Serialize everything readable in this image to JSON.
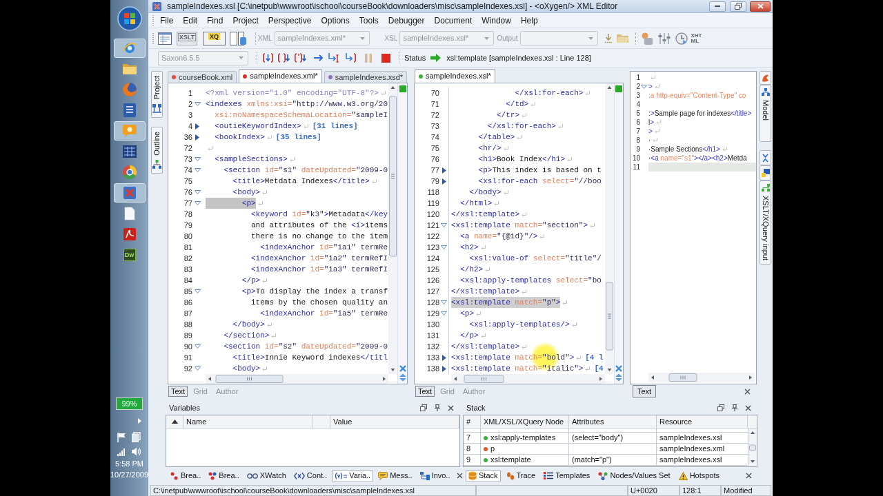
{
  "taskbar": {
    "apps": [
      {
        "kind": "ie",
        "open": true
      },
      {
        "kind": "folder",
        "open": false
      },
      {
        "kind": "firefox",
        "open": false
      },
      {
        "kind": "word",
        "open": false
      },
      {
        "kind": "chat",
        "open": true
      },
      {
        "kind": "grid",
        "open": false
      },
      {
        "kind": "globe",
        "open": false
      },
      {
        "kind": "oxygen",
        "open": true
      },
      {
        "kind": "page",
        "open": false
      },
      {
        "kind": "acrobat",
        "open": false
      },
      {
        "kind": "dw",
        "open": false,
        "text": "Dw"
      }
    ],
    "battery": {
      "reading": "99%",
      "level": 0.99
    },
    "time": "5:58 PM",
    "date": "10/27/2009"
  },
  "window": {
    "title": "sampleIndexes.xsl [C:\\inetpub\\wwwroot\\ischool\\courseBook\\downloaders\\misc\\sampleIndexes.xsl] - <oXygen/> XML Editor"
  },
  "menu": [
    "File",
    "Edit",
    "Find",
    "Project",
    "Perspective",
    "Options",
    "Tools",
    "Debugger",
    "Document",
    "Window",
    "Help"
  ],
  "toolbar": {
    "xslt_icon_text": "XSLT",
    "xquery_icon_text": "XQ",
    "combos": [
      {
        "label": "XML",
        "value": "sampleIndexes.xml*",
        "disabled": true
      },
      {
        "label": "XSL",
        "value": "sampleIndexes.xsl*",
        "disabled": true
      },
      {
        "label": "Output",
        "disabled": true
      }
    ],
    "xhtml_icon_text": [
      "XHT",
      "ML"
    ]
  },
  "debug_bar": {
    "engine": {
      "value": "Saxon6.5.5",
      "disabled": true
    },
    "status_label": "Status",
    "status": "xsl:template [sampleIndexes.xsl : Line 128]"
  },
  "side_tabs": [
    {
      "label": "Project"
    },
    {
      "label": "Outline"
    }
  ],
  "editors": [
    {
      "tabs": [
        {
          "label": "courseBook.xml",
          "color": "#e24a3c",
          "selected": false
        },
        {
          "label": "sampleIndexes.xml*",
          "color": "#d8332a",
          "selected": true
        },
        {
          "label": "sampleIndexes.xsd*",
          "color": "#8e6fb5",
          "selected": false
        }
      ],
      "lines": [
        {
          "n": "1",
          "text": "<?xml version=\"1.0\" encoding=\"UTF-8\"?>",
          "eol": true,
          "highlighted": false
        },
        {
          "n": "2",
          "expanded": true,
          "text": "<indexes xmlns:xsi=\"http://www.w3.org/20",
          "eol": false,
          "highlighted": false
        },
        {
          "n": "3",
          "text": "  xsi:noNamespaceSchemaLocation=\"sampleI",
          "eol": false,
          "highlighted": false
        },
        {
          "n": "4",
          "expanded": false,
          "text": "  <outieKeywordIndex>",
          "eol": true,
          "summary": "[31 lines]",
          "highlighted": false
        },
        {
          "n": "36",
          "expanded": false,
          "text": "  <bookIndex>",
          "eol": true,
          "summary": "[35 lines]",
          "highlighted": false
        },
        {
          "n": "72",
          "eol": true,
          "highlighted": false
        },
        {
          "n": "73",
          "expanded": true,
          "text": "  <sampleSections>",
          "eol": true,
          "highlighted": false
        },
        {
          "n": "74",
          "expanded": true,
          "text": "    <section id=\"s1\" dateUpdated=\"2009-0",
          "eol": false,
          "highlighted": false
        },
        {
          "n": "75",
          "text": "      <title>Metdata Indexes</title>",
          "eol": true,
          "highlighted": false
        },
        {
          "n": "76",
          "expanded": true,
          "text": "      <body>",
          "eol": true,
          "highlighted": false
        },
        {
          "n": "77",
          "expanded": true,
          "text": "        <p>",
          "eol": true,
          "highlighted": true
        },
        {
          "n": "78",
          "text": "          <keyword id=\"k3\">Metadata</key",
          "eol": false,
          "highlighted": false
        },
        {
          "n": "79",
          "text": "          and attributes of the <i>items",
          "eol": false,
          "highlighted": false
        },
        {
          "n": "80",
          "text": "          there is no change to the item",
          "eol": false,
          "highlighted": false
        },
        {
          "n": "81",
          "text": "            <indexAnchor id=\"ia1\" termRe",
          "eol": false,
          "highlighted": false
        },
        {
          "n": "82",
          "text": "          <indexAnchor id=\"ia2\" termRefI",
          "eol": false,
          "highlighted": false
        },
        {
          "n": "83",
          "text": "          <indexAnchor id=\"ia3\" termRefI",
          "eol": false,
          "highlighted": false
        },
        {
          "n": "84",
          "text": "        </p>",
          "eol": true,
          "highlighted": false
        },
        {
          "n": "85",
          "expanded": true,
          "text": "        <p>To display the index a transf",
          "eol": false,
          "highlighted": false
        },
        {
          "n": "86",
          "text": "          items by the chosen quality an",
          "eol": false,
          "highlighted": false
        },
        {
          "n": "87",
          "text": "            <indexAnchor id=\"ia5\" termRe",
          "eol": false,
          "highlighted": false
        },
        {
          "n": "88",
          "text": "      </body>",
          "eol": true,
          "highlighted": false
        },
        {
          "n": "89",
          "text": "    </section>",
          "eol": true,
          "highlighted": false
        },
        {
          "n": "90",
          "expanded": true,
          "text": "    <section id=\"s2\" dateUpdated=\"2009-0",
          "eol": false,
          "highlighted": false
        },
        {
          "n": "91",
          "text": "      <title>Innie Keyword indexes</titl",
          "eol": false,
          "highlighted": false
        },
        {
          "n": "92",
          "expanded": true,
          "text": "      <body>",
          "eol": true,
          "highlighted": false
        }
      ],
      "modes": [
        {
          "label": "Text",
          "selected": true
        },
        {
          "label": "Grid",
          "selected": false
        },
        {
          "label": "Author",
          "selected": false
        }
      ]
    },
    {
      "tabs": [
        {
          "label": "sampleIndexes.xsl*",
          "color": "#3fae3a",
          "selected": true
        }
      ],
      "lines": [
        {
          "n": "70",
          "text": "              </xsl:for-each>",
          "eol": true,
          "highlighted": false
        },
        {
          "n": "71",
          "text": "            </td>",
          "eol": true,
          "highlighted": false
        },
        {
          "n": "72",
          "text": "          </tr>",
          "eol": true,
          "highlighted": false
        },
        {
          "n": "73",
          "text": "        </xsl:for-each>",
          "eol": true,
          "highlighted": false
        },
        {
          "n": "74",
          "text": "      </table>",
          "eol": true,
          "highlighted": false
        },
        {
          "n": "75",
          "text": "      <hr/>",
          "eol": true,
          "highlighted": false
        },
        {
          "n": "76",
          "text": "      <h1>Book Index</h1>",
          "eol": true,
          "highlighted": false
        },
        {
          "n": "77",
          "expanded": false,
          "text": "      <p>This index is based on t",
          "eol": false,
          "highlighted": false
        },
        {
          "n": "79",
          "expanded": false,
          "text": "      <xsl:for-each select=\"//boo",
          "eol": false,
          "highlighted": false
        },
        {
          "n": "118",
          "text": "    </body>",
          "eol": true,
          "highlighted": false
        },
        {
          "n": "119",
          "text": "  </html>",
          "eol": true,
          "highlighted": false
        },
        {
          "n": "120",
          "text": "</xsl:template>",
          "eol": true,
          "highlighted": false
        },
        {
          "n": "121",
          "expanded": true,
          "text": "<xsl:template match=\"section\">",
          "eol": true,
          "highlighted": false
        },
        {
          "n": "122",
          "text": "  <a name=\"{@id}\"/>",
          "eol": true,
          "highlighted": false
        },
        {
          "n": "123",
          "expanded": true,
          "text": "  <h2>",
          "eol": true,
          "highlighted": false
        },
        {
          "n": "124",
          "text": "    <xsl:value-of select=\"title\"/",
          "eol": false,
          "highlighted": false
        },
        {
          "n": "125",
          "text": "  </h2>",
          "eol": true,
          "highlighted": false
        },
        {
          "n": "126",
          "text": "  <xsl:apply-templates select=\"bo",
          "eol": false,
          "highlighted": false
        },
        {
          "n": "127",
          "text": "</xsl:template>",
          "eol": true,
          "highlighted": false
        },
        {
          "n": "128",
          "expanded": true,
          "text": "<xsl:template match=\"p\">",
          "eol": true,
          "highlighted": true
        },
        {
          "n": "129",
          "expanded": true,
          "text": "  <p>",
          "eol": true,
          "highlighted": false
        },
        {
          "n": "130",
          "text": "    <xsl:apply-templates/>",
          "eol": true,
          "highlighted": false
        },
        {
          "n": "131",
          "text": "  </p>",
          "eol": true,
          "highlighted": false
        },
        {
          "n": "132",
          "text": "</xsl:template>",
          "eol": true,
          "highlighted": false
        },
        {
          "n": "133",
          "expanded": false,
          "text": "<xsl:template match=\"bold\">",
          "eol": true,
          "summary": "[4 l",
          "highlighted": false
        },
        {
          "n": "138",
          "expanded": false,
          "text": "<xsl:template match=\"italic\">",
          "eol": true,
          "summary": "[4",
          "highlighted": false
        }
      ],
      "modes": [
        {
          "label": "Text",
          "selected": true
        },
        {
          "label": "Grid",
          "selected": false
        },
        {
          "label": "Author",
          "selected": false
        }
      ]
    }
  ],
  "output": {
    "lines": [
      {
        "n": "1",
        "eol": true,
        "highlighted": false
      },
      {
        "n": "2",
        "expanded": true,
        "text": ">",
        "eol": true,
        "highlighted": false
      },
      {
        "n": "3",
        "text": ":a http-equiv=\"Content-Type\" co",
        "eol": false,
        "highlighted": false
      },
      {
        "n": "4",
        "eol": false,
        "highlighted": false
      },
      {
        "n": "5",
        "text": ":>Sample page for indexes</title>",
        "eol": false,
        "highlighted": false
      },
      {
        "n": "6",
        "text": "l>",
        "eol": true,
        "highlighted": false
      },
      {
        "n": "7",
        "text": ">",
        "eol": true,
        "highlighted": false
      },
      {
        "n": "8",
        "text": "·",
        "eol": true,
        "highlighted": false
      },
      {
        "n": "9",
        "text": "·Sample Sections</h1>",
        "eol": true,
        "highlighted": false
      },
      {
        "n": "10",
        "text": "·<a name=\"s1\"></a><h2>Metda",
        "eol": false,
        "highlighted": false
      },
      {
        "n": "11",
        "eol": false,
        "highlighted": true
      }
    ],
    "modes": [
      {
        "label": "Text",
        "selected": true
      }
    ]
  },
  "right_tabs": [
    {
      "label": "Model"
    },
    {
      "label": "XSLT/XQuery input"
    }
  ],
  "variables": {
    "title": "Variables",
    "columns": [
      "Name",
      "Value"
    ]
  },
  "stack": {
    "title": "Stack",
    "columns": [
      "#",
      "XML/XSL/XQuery Node",
      "Attributes",
      "Resource"
    ],
    "rows": [
      {
        "index": "7",
        "color": "#3fae3a",
        "node": "xsl:apply-templates",
        "attributes": "(select=\"body\")",
        "resource": "sampleIndexes.xsl"
      },
      {
        "index": "8",
        "color": "#e0542a",
        "node": "p",
        "resource": "sampleIndexes.xml"
      },
      {
        "index": "9",
        "color": "#3fae3a",
        "node": "xsl:template",
        "attributes": "(match=\"p\")",
        "resource": "sampleIndexes.xsl"
      }
    ]
  },
  "bottom_tabs": {
    "left": [
      {
        "label": "Brea..",
        "selected": false
      },
      {
        "label": "Brea..",
        "selected": false
      },
      {
        "label": "XWatch",
        "selected": false
      },
      {
        "label": "Cont..",
        "selected": false
      },
      {
        "label": "Varia..",
        "selected": true
      },
      {
        "label": "Mess..",
        "selected": false
      },
      {
        "label": "Invo..",
        "selected": false
      }
    ],
    "right": [
      {
        "label": "Stack",
        "selected": true
      },
      {
        "label": "Trace",
        "selected": false
      },
      {
        "label": "Templates",
        "selected": false
      },
      {
        "label": "Nodes/Values Set",
        "selected": false
      },
      {
        "label": "Hotspots",
        "selected": false
      }
    ]
  },
  "status_bar": {
    "path": "C:\\inetpub\\wwwroot\\ischool\\courseBook\\downloaders\\misc\\sampleIndexes.xsl",
    "char": "U+0020",
    "position": "128:1",
    "state": "Modified"
  }
}
